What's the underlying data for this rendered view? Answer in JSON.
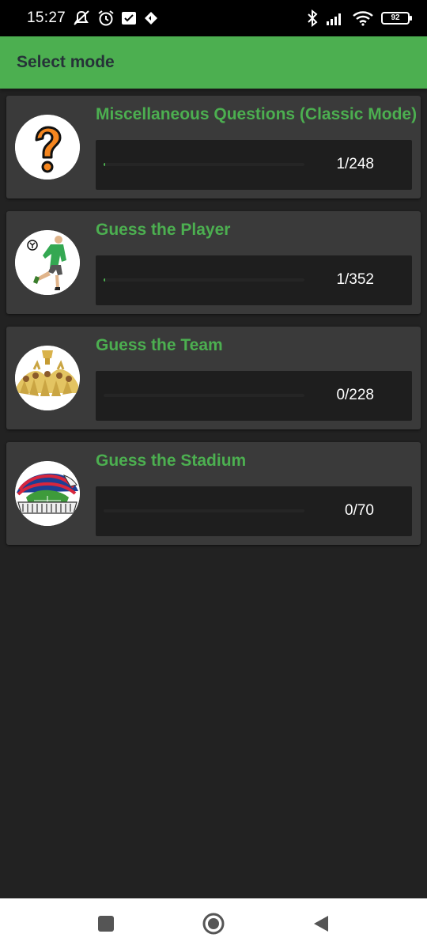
{
  "status_bar": {
    "time": "15:27",
    "battery": "92",
    "icons": [
      "mute-icon",
      "alarm-icon",
      "checkbox-icon",
      "data-saver-icon",
      "bluetooth-icon",
      "signal-icon",
      "wifi-icon",
      "battery-icon"
    ]
  },
  "app_bar": {
    "title": "Select mode"
  },
  "modes": [
    {
      "title": "Miscellaneous Questions (Classic Mode)",
      "progress_text": "1/248",
      "progress_fraction": 0.004,
      "icon": "question-mark-icon"
    },
    {
      "title": "Guess the Player",
      "progress_text": "1/352",
      "progress_fraction": 0.003,
      "icon": "football-player-icon"
    },
    {
      "title": "Guess the Team",
      "progress_text": "0/228",
      "progress_fraction": 0,
      "icon": "team-trophy-icon"
    },
    {
      "title": "Guess the Stadium",
      "progress_text": "0/70",
      "progress_fraction": 0,
      "icon": "stadium-icon"
    }
  ],
  "nav_bar": {
    "buttons": [
      "recents-button",
      "home-button",
      "back-button"
    ]
  },
  "colors": {
    "accent": "#4caf50",
    "background": "#222222",
    "card": "#3a3a3a",
    "progress_box": "#1e1e1e"
  }
}
